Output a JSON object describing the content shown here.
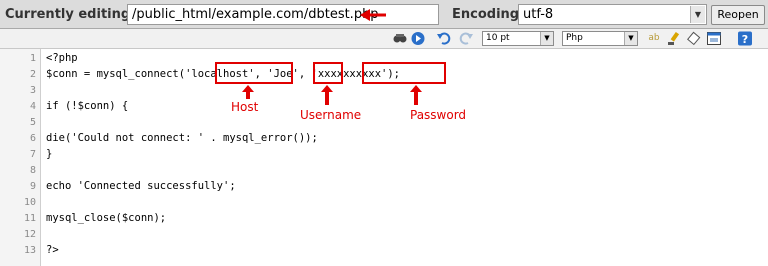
{
  "header": {
    "editing_label": "Currently editing:",
    "path_value": "/public_html/example.com/dbtest.php",
    "encoding_label": "Encoding:",
    "encoding_value": "utf-8",
    "reopen_label": "Reopen"
  },
  "toolbar": {
    "font_size": "10 pt",
    "syntax": "Php",
    "icons": [
      "find-icon",
      "goto-icon",
      "undo-icon",
      "redo-icon",
      "spellcheck-icon",
      "highlight-icon",
      "eraser-icon",
      "fullscreen-icon",
      "help-icon"
    ]
  },
  "editor": {
    "line_numbers": [
      "1",
      "2",
      "3",
      "4",
      "5",
      "6",
      "7",
      "8",
      "9",
      "10",
      "11",
      "12",
      "13"
    ],
    "lines": [
      "<?php",
      "$conn = mysql_connect('localhost', 'Joe', 'xxxxxxxxxx');",
      "",
      "if (!$conn) {",
      "",
      "die('Could not connect: ' . mysql_error());",
      "}",
      "",
      "echo 'Connected successfully';",
      "",
      "mysql_close($conn);",
      "",
      "?>"
    ]
  },
  "annotations": {
    "host": "Host",
    "username": "Username",
    "password": "Password"
  },
  "colors": {
    "annotation": "#e00000",
    "keyword": "#0000cc",
    "string": "#cc0000"
  }
}
